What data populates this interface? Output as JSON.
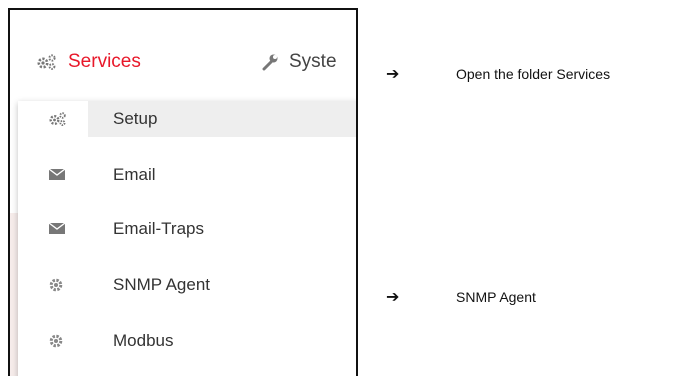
{
  "nav": {
    "services_label": "Services",
    "system_label": "Syste",
    "services_icon": "gears-icon",
    "system_icon": "wrench-icon",
    "accent": "#e8182a"
  },
  "menu": {
    "items": [
      {
        "label": "Setup",
        "icon": "gears-icon",
        "active": true
      },
      {
        "label": "Email",
        "icon": "envelope-icon"
      },
      {
        "label": "Email-Traps",
        "icon": "envelope-icon"
      },
      {
        "label": "SNMP Agent",
        "icon": "gear-icon"
      },
      {
        "label": "Modbus",
        "icon": "gear-icon"
      }
    ]
  },
  "notes": [
    {
      "arrow": "➔",
      "text": "Open the folder Services"
    },
    {
      "arrow": "➔",
      "text": "SNMP Agent"
    }
  ]
}
